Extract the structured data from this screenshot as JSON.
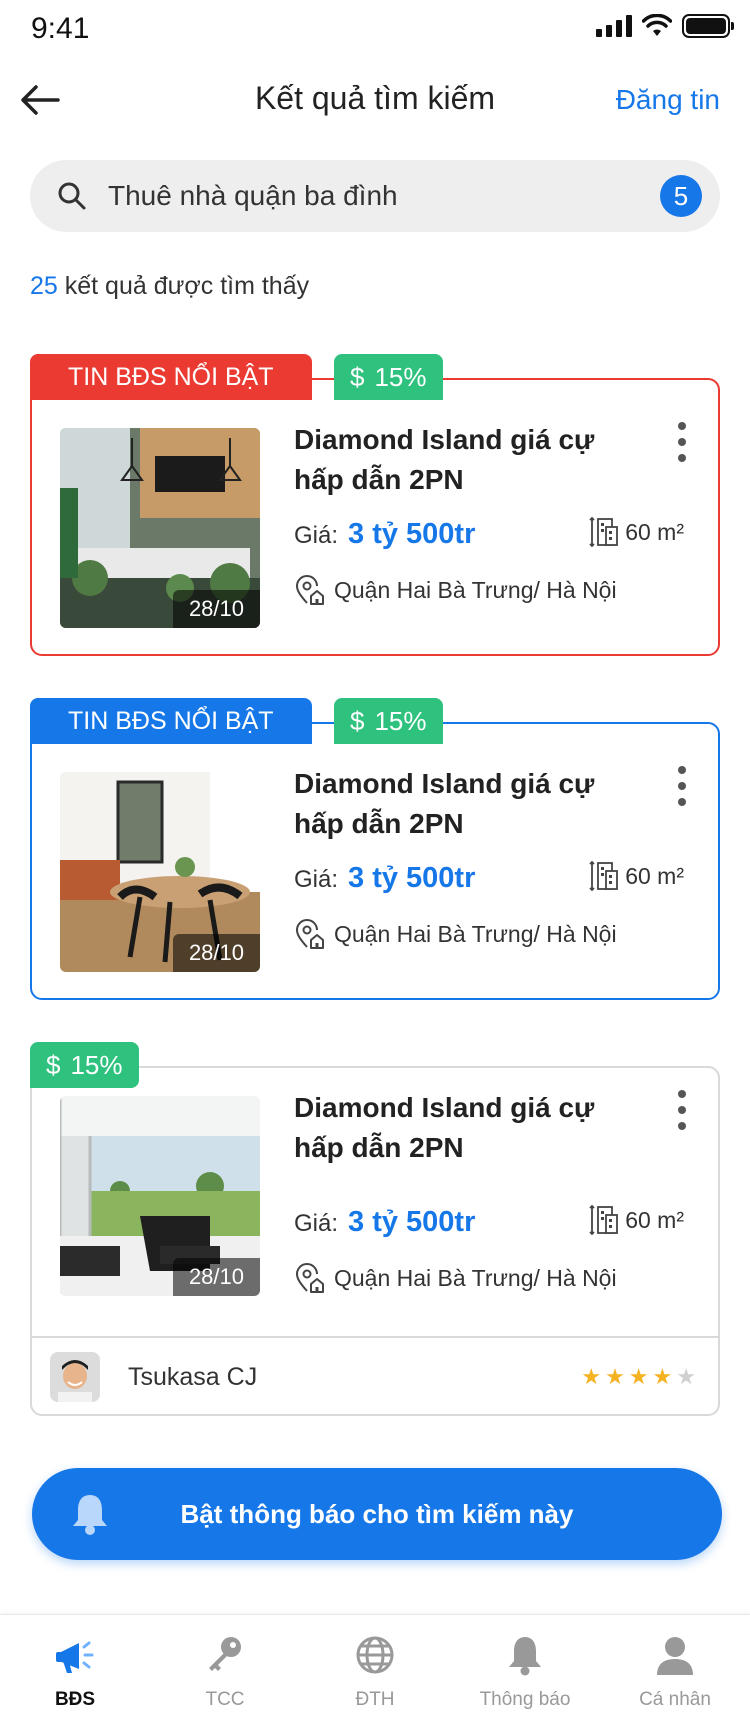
{
  "status_bar": {
    "time": "9:41"
  },
  "header": {
    "title": "Kết quả tìm kiếm",
    "post_label": "Đăng tin"
  },
  "search": {
    "value": "Thuê nhà quận ba đình",
    "filter_count": "5"
  },
  "results": {
    "count": "25",
    "text": " kết quả được tìm thấy"
  },
  "listings": [
    {
      "featured_label": "TIN BĐS NỔI BẬT",
      "discount_icon": "$",
      "discount": "15%",
      "date": "28/10",
      "title": "Diamond Island giá cự hấp dẫn 2PN",
      "price_label": "Giá:",
      "price": "3 tỷ 500tr",
      "area": "60 m²",
      "location": "Quận Hai Bà Trưng/ Hà Nội",
      "style": "red"
    },
    {
      "featured_label": "TIN BĐS NỔI BẬT",
      "discount_icon": "$",
      "discount": "15%",
      "date": "28/10",
      "title": "Diamond Island giá cự hấp dẫn 2PN",
      "price_label": "Giá:",
      "price": "3 tỷ 500tr",
      "area": "60 m²",
      "location": "Quận Hai Bà Trưng/ Hà Nội",
      "style": "blue"
    },
    {
      "discount_icon": "$",
      "discount": "15%",
      "date": "28/10",
      "title": "Diamond Island giá cự hấp dẫn 2PN",
      "price_label": "Giá:",
      "price": "3 tỷ 500tr",
      "area": "60 m²",
      "location": "Quận Hai Bà Trưng/ Hà Nội",
      "owner_name": "Tsukasa CJ",
      "rating": 4,
      "rating_max": 5
    }
  ],
  "notify_button": {
    "label": "Bật thông báo cho tìm kiếm này"
  },
  "bottom_nav": [
    {
      "label": "BĐS",
      "icon": "megaphone-icon",
      "active": true
    },
    {
      "label": "TCC",
      "icon": "key-icon",
      "active": false
    },
    {
      "label": "ĐTH",
      "icon": "globe-icon",
      "active": false
    },
    {
      "label": "Thông báo",
      "icon": "bell-icon",
      "active": false
    },
    {
      "label": "Cá nhân",
      "icon": "user-icon",
      "active": false
    }
  ],
  "colors": {
    "primary": "#1677e8",
    "featured_red": "#ea3a32",
    "discount_green": "#2ec27e",
    "star": "#f5b223"
  }
}
